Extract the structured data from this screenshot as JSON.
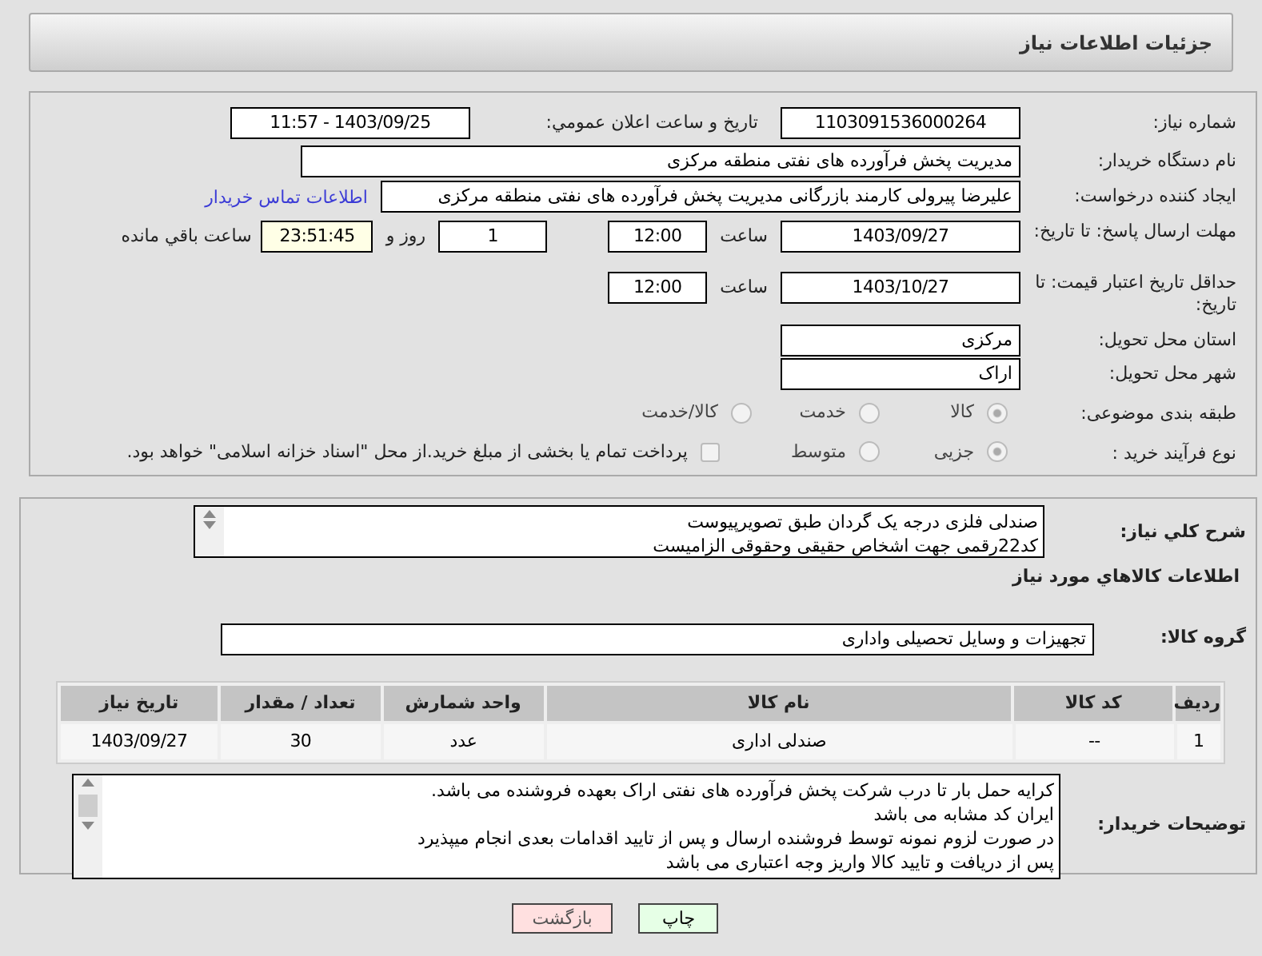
{
  "header": {
    "title": "جزئیات اطلاعات نیاز"
  },
  "need_number": {
    "label": "شماره نیاز:",
    "value": "1103091536000264"
  },
  "announce": {
    "label": "تاريخ و ساعت اعلان عمومي:",
    "value": "1403/09/25 - 11:57"
  },
  "buyer_org": {
    "label": "نام دستگاه خریدار:",
    "value": "مدیریت پخش فرآورده های نفتی منطقه مرکزی"
  },
  "requester": {
    "label": "ایجاد کننده درخواست:",
    "value": "علیرضا پیرولی کارمند بازرگانی مدیریت پخش فرآورده های نفتی منطقه مرکزی",
    "link": "اطلاعات تماس خریدار"
  },
  "reply_deadline": {
    "label": "مهلت ارسال پاسخ: تا تاریخ:",
    "date": "1403/09/27",
    "time_label": "ساعت",
    "time": "12:00",
    "days": "1",
    "days_label": "روز و",
    "remaining": "23:51:45",
    "remaining_label": "ساعت باقي مانده"
  },
  "price_validity": {
    "label": "حداقل تاریخ اعتبار قیمت: تا تاریخ:",
    "date": "1403/10/27",
    "time_label": "ساعت",
    "time": "12:00"
  },
  "province": {
    "label": "استان محل تحویل:",
    "value": "مرکزی"
  },
  "city": {
    "label": "شهر محل تحویل:",
    "value": "اراک"
  },
  "category": {
    "label": "طبقه بندی موضوعی:",
    "options": [
      {
        "label": "کالا",
        "selected": true
      },
      {
        "label": "خدمت",
        "selected": false
      },
      {
        "label": "کالا/خدمت",
        "selected": false
      }
    ]
  },
  "process": {
    "label": "نوع فرآیند خرید :",
    "options": [
      {
        "label": "جزیی",
        "selected": true
      },
      {
        "label": "متوسط",
        "selected": false
      }
    ],
    "treasury": {
      "label": "پرداخت تمام یا بخشی از مبلغ خرید.از محل \"اسناد خزانه اسلامی\" خواهد بود.",
      "checked": false
    }
  },
  "description": {
    "label": "شرح کلي نياز:",
    "lines": [
      "صندلی فلزی درجه یک گردان طبق تصویرپیوست",
      "کد22رقمی  جهت اشخاص حقیقی وحقوقی الزامیست"
    ]
  },
  "goods_title": "اطلاعات کالاهاي مورد نياز",
  "goods_group": {
    "label": "گروه کالا:",
    "value": "تجهیزات و وسایل تحصیلی واداری"
  },
  "table": {
    "columns": [
      "ردیف",
      "کد کالا",
      "نام کالا",
      "واحد شمارش",
      "تعداد / مقدار",
      "تاریخ نیاز"
    ],
    "rows": [
      [
        "1",
        "--",
        "صندلی اداری",
        "عدد",
        "30",
        "1403/09/27"
      ]
    ]
  },
  "buyer_notes": {
    "label": "توضیحات خریدار:",
    "lines": [
      "کرایه حمل بار تا درب شرکت  پخش فرآورده های نفتی اراک بعهده فروشنده می باشد.",
      "ایران کد مشابه می باشد",
      "در صورت لزوم نمونه توسط فروشنده ارسال و پس از تایید اقدامات بعدی انجام میپذیرد",
      "پس از دریافت و تایید کالا واریز وجه اعتباری می باشد"
    ]
  },
  "buttons": [
    {
      "label": "چاپ",
      "kind": "print"
    },
    {
      "label": "بازگشت",
      "kind": "back"
    }
  ]
}
